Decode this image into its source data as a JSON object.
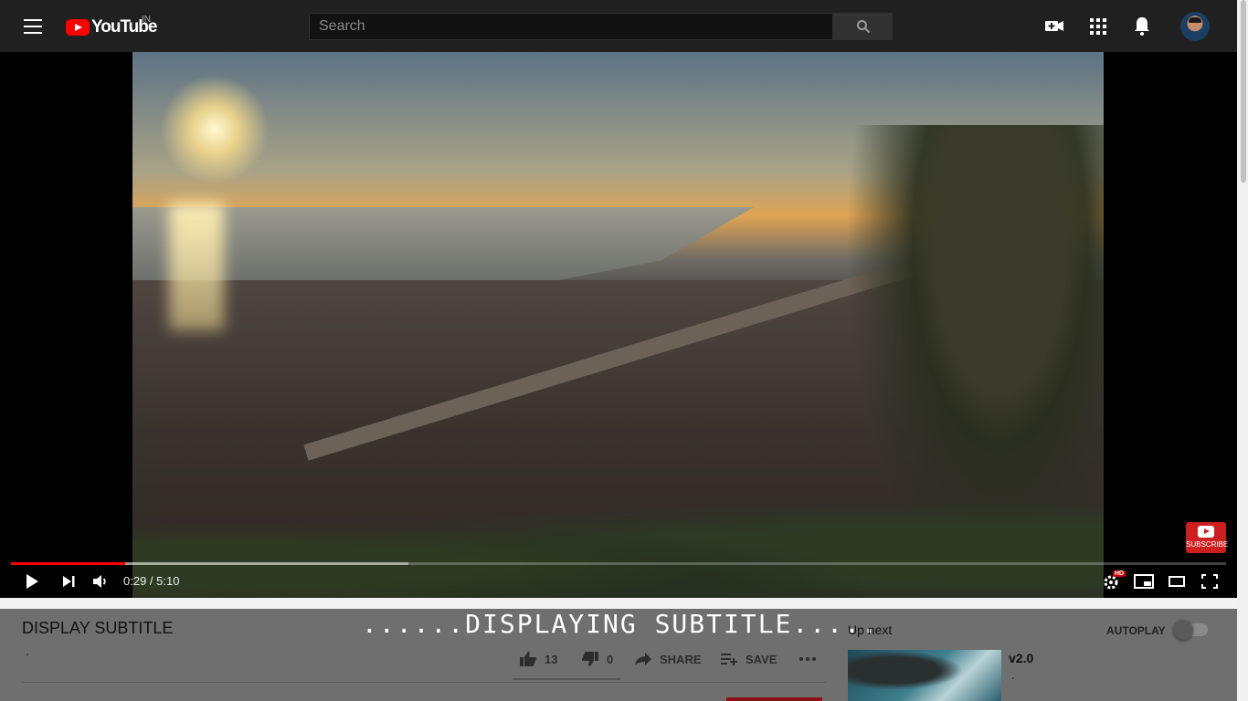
{
  "header": {
    "logo_text": "YouTube",
    "region": "IN",
    "search_placeholder": "Search",
    "icons": [
      "menu-icon",
      "search-icon",
      "create-video-icon",
      "apps-grid-icon",
      "notifications-bell-icon",
      "avatar"
    ]
  },
  "player": {
    "current_time": "0:29",
    "duration": "5:10",
    "time_separator": " / ",
    "played_fraction": 0.094,
    "buffered_fraction": 0.327,
    "quality_badge": "HD",
    "watermark_label": "SUBSCRIBE",
    "controls": [
      "play-icon",
      "next-icon",
      "volume-icon",
      "settings-icon",
      "miniplayer-icon",
      "theater-mode-icon",
      "fullscreen-icon"
    ]
  },
  "video": {
    "title": "DISPLAY SUBTITLE",
    "views": ".",
    "subtitle_overlay": "......DISPLAYING SUBTITLE.....",
    "likes": "13",
    "dislikes": "0",
    "share_label": "SHARE",
    "save_label": "SAVE"
  },
  "sidebar": {
    "up_next_label": "Up next",
    "autoplay_label": "AUTOPLAY",
    "autoplay_on": false,
    "recommendations": [
      {
        "title": "v2.0",
        "channel": "."
      }
    ]
  },
  "colors": {
    "accent": "#ff0000",
    "header_bg": "#202020"
  }
}
